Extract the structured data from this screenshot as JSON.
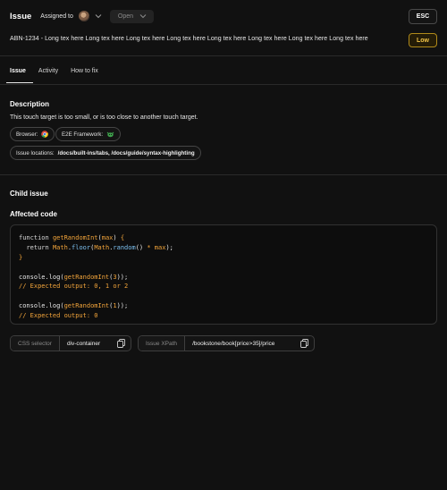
{
  "header": {
    "title": "Issue",
    "assigned_label": "Assigned to",
    "status": "Open",
    "esc_label": "ESC"
  },
  "issue": {
    "summary": "ABN-1234 - Long tex here Long tex here Long tex here Long tex here Long tex here Long tex here Long tex here Long tex here",
    "priority": "Low",
    "priority_color": "#f3c548"
  },
  "tabs": [
    {
      "label": "Issue"
    },
    {
      "label": "Activity"
    },
    {
      "label": "How to fix"
    }
  ],
  "description": {
    "title": "Description",
    "text": "This touch target is too small, or is too close to another touch target.",
    "browser_label": "Browser:",
    "framework_label": "E2E Framework:",
    "locations_label": "Issue locations:",
    "locations_value": "/docs/built-ins/tabs, /docs/guide/syntax-highlighting"
  },
  "child": {
    "title": "Child issue",
    "affected_code_title": "Affected code"
  },
  "code": {
    "lines": [
      "function getRandomInt(max) {",
      "  return Math.floor(Math.random() * max);",
      "}",
      "",
      "console.log(getRandomInt(3));",
      "// Expected output: 0, 1 or 2",
      "",
      "console.log(getRandomInt(1));",
      "// Expected output: 0"
    ]
  },
  "selectors": {
    "css_label": "CSS selector",
    "css_value": "div-container",
    "xpath_label": "Issue XPath",
    "xpath_value": "/bookstone/book[price>35]/price"
  }
}
